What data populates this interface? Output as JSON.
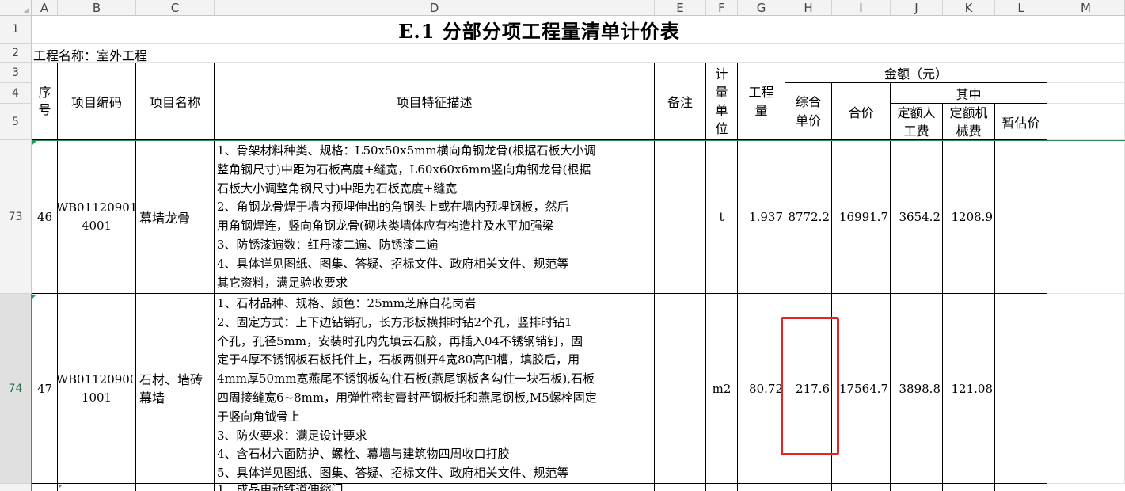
{
  "columns": [
    "A",
    "B",
    "C",
    "D",
    "E",
    "F",
    "G",
    "H",
    "I",
    "J",
    "K",
    "L",
    "M"
  ],
  "rows": {
    "r1": "1",
    "r2": "2",
    "r3": "3",
    "r4": "4",
    "r5": "5",
    "r73": "73",
    "r74": "74"
  },
  "sheet": {
    "title": "E.1  分部分项工程量清单计价表",
    "project_label": "工程名称：室外工程"
  },
  "headers": {
    "seq": "序号",
    "code": "项目编码",
    "name": "项目名称",
    "desc": "项目特征描述",
    "note": "备注",
    "unit": "计量单位",
    "qty": "工程量",
    "amount": "金额（元）",
    "unit_price": "综合单价",
    "total": "合价",
    "of_which": "其中",
    "labor": "定额人工费",
    "machine": "定额机械费",
    "provisional": "暂估价"
  },
  "items": [
    {
      "seq": "46",
      "code": "WB01120901\n4001",
      "name": "幕墙龙骨",
      "desc": "1、骨架材料种类、规格：L50x50x5mm横向角钢龙骨(根据石板大小调\n整角钢尺寸)中距为石板高度+缝宽，L60x60x6mm竖向角钢龙骨(根据\n石板大小调整角钢尺寸)中距为石板宽度+缝宽\n2、角钢龙骨焊于墙内预埋伸出的角钢头上或在墙内预埋钢板，然后\n用角钢焊连，竖向角钢龙骨(砌块类墙体应有构造柱及水平加强梁\n3、防锈漆遍数：红丹漆二遍、防锈漆二遍\n4、具体详见图纸、图集、答疑、招标文件、政府相关文件、规范等\n其它资料，满足验收要求",
      "unit": "t",
      "qty": "1.937",
      "unit_price": "8772.2",
      "total": "16991.7",
      "labor": "3654.2",
      "machine": "1208.9"
    },
    {
      "seq": "47",
      "code": "WB01120900\n1001",
      "name": "石材、墙砖\n幕墙",
      "desc": "1、石材品种、规格、颜色：25mm芝麻白花岗岩\n2、固定方式：上下边钻销孔，长方形板横排时钻2个孔，竖排时钻1\n个孔，孔径5mm，安装时孔内先填云石胶，再插入04不锈钢销钉，固\n定于4厚不锈钢板石板托件上，石板两侧开4宽80高凹槽，填胶后，用\n4mm厚50mm宽燕尾不锈钢板勾住石板(燕尾钢板各勾住一块石板),石板\n四周接缝宽6~8mm，用弹性密封膏封严钢板托和燕尾钢板,M5螺栓固定\n于竖向角钺骨上\n3、防火要求：满足设计要求\n4、含石材六面防护、螺栓、幕墙与建筑物四周收口打胶\n5、具体详见图纸、图集、答疑、招标文件、政府相关文件、规范等",
      "unit": "m2",
      "qty": "80.72",
      "unit_price": "217.6",
      "total": "17564.7",
      "labor": "3898.8",
      "machine": "121.08"
    }
  ],
  "next_row_partial": "1、成品电动铁道伸缩门"
}
